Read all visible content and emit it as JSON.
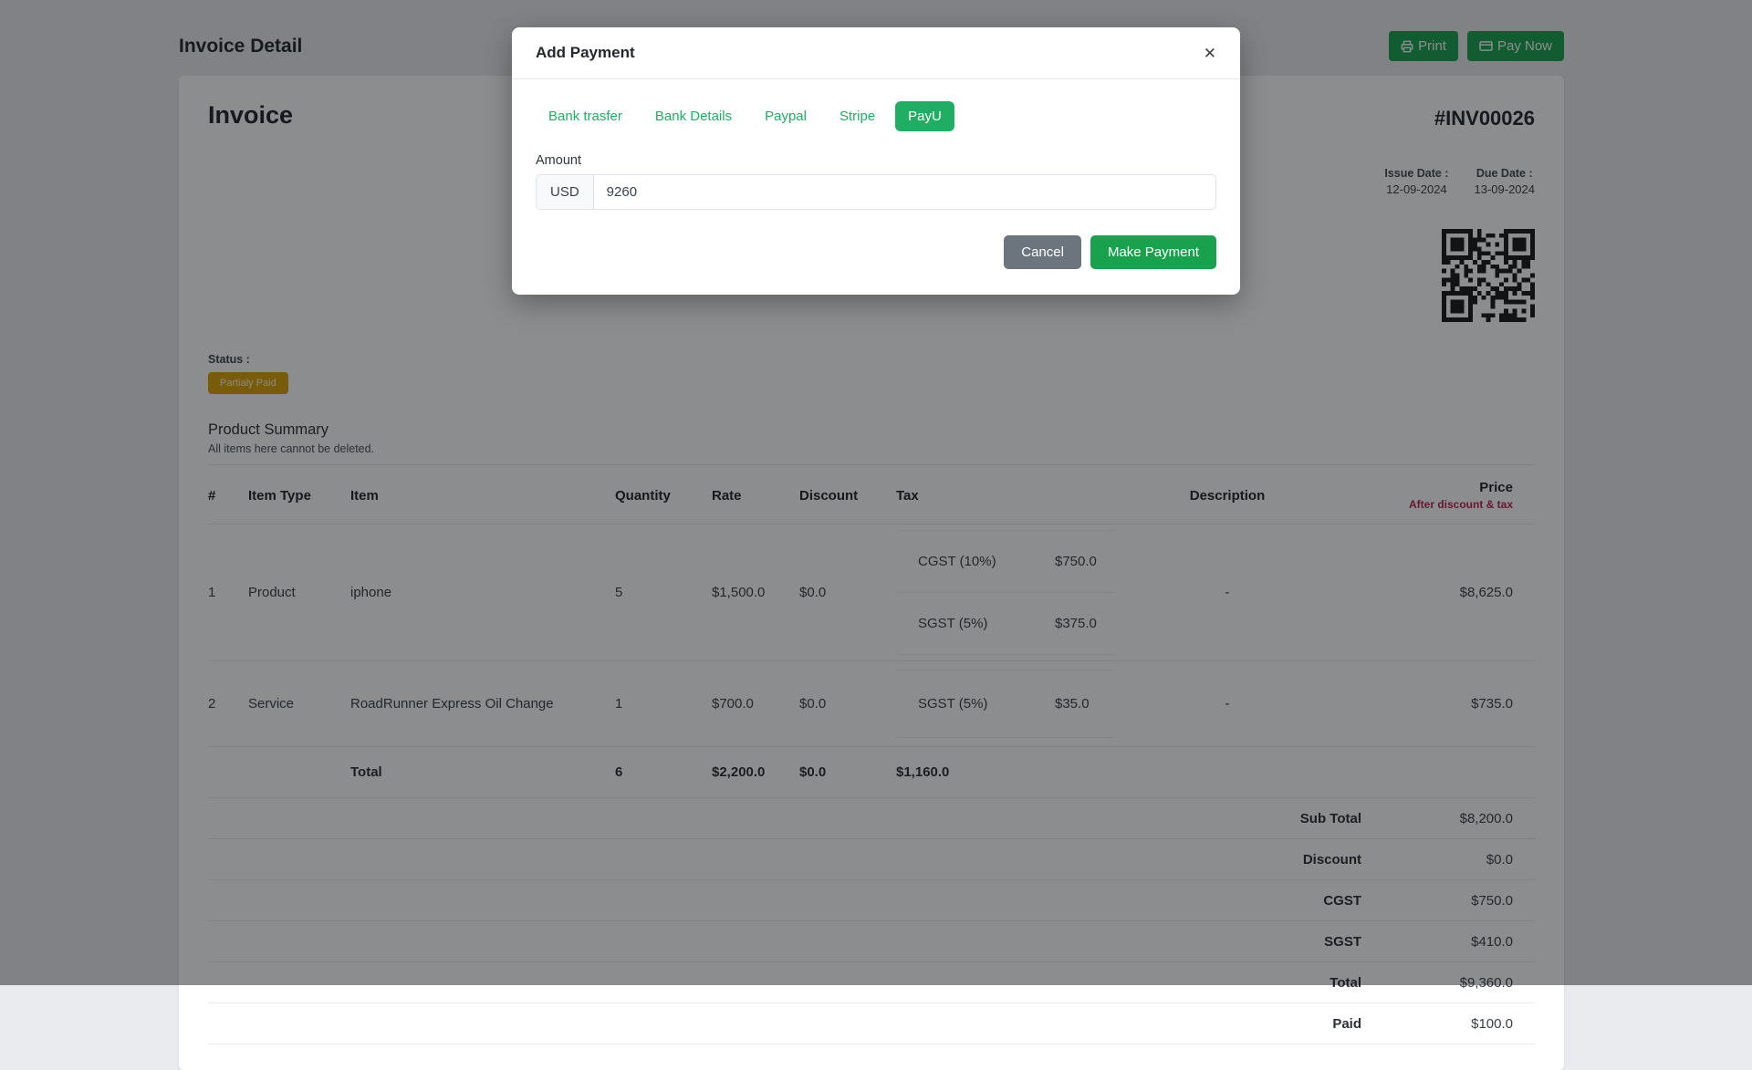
{
  "page": {
    "title": "Invoice Detail",
    "print_label": "Print",
    "pay_now_label": "Pay Now"
  },
  "invoice": {
    "title": "Invoice",
    "number": "#INV00026",
    "issue_date_label": "Issue Date :",
    "issue_date": "12-09-2024",
    "due_date_label": "Due Date :",
    "due_date": "13-09-2024",
    "status_label": "Status :",
    "status": "Partialy Paid"
  },
  "product_summary": {
    "title": "Product Summary",
    "subtitle": "All items here cannot be deleted.",
    "columns": {
      "index": "#",
      "item_type": "Item Type",
      "item": "Item",
      "quantity": "Quantity",
      "rate": "Rate",
      "discount": "Discount",
      "tax": "Tax",
      "description": "Description",
      "price": "Price",
      "price_sub": "After discount & tax"
    },
    "rows": [
      {
        "index": "1",
        "item_type": "Product",
        "item": "iphone",
        "quantity": "5",
        "rate": "$1,500.0",
        "discount": "$0.0",
        "taxes": [
          {
            "name": "CGST (10%)",
            "value": "$750.0"
          },
          {
            "name": "SGST (5%)",
            "value": "$375.0"
          }
        ],
        "description": "-",
        "price": "$8,625.0"
      },
      {
        "index": "2",
        "item_type": "Service",
        "item": "RoadRunner Express Oil Change",
        "quantity": "1",
        "rate": "$700.0",
        "discount": "$0.0",
        "taxes": [
          {
            "name": "SGST (5%)",
            "value": "$35.0"
          }
        ],
        "description": "-",
        "price": "$735.0"
      }
    ],
    "total_row": {
      "label": "Total",
      "quantity": "6",
      "rate": "$2,200.0",
      "discount": "$0.0",
      "tax": "$1,160.0"
    },
    "summary": [
      {
        "label": "Sub Total",
        "value": "$8,200.0"
      },
      {
        "label": "Discount",
        "value": "$0.0"
      },
      {
        "label": "CGST",
        "value": "$750.0"
      },
      {
        "label": "SGST",
        "value": "$410.0"
      },
      {
        "label": "Total",
        "value": "$9,360.0"
      },
      {
        "label": "Paid",
        "value": "$100.0"
      }
    ]
  },
  "modal": {
    "title": "Add Payment",
    "close_glyph": "✕",
    "tabs": [
      {
        "label": "Bank trasfer",
        "active": false
      },
      {
        "label": "Bank Details",
        "active": false
      },
      {
        "label": "Paypal",
        "active": false
      },
      {
        "label": "Stripe",
        "active": false
      },
      {
        "label": "PayU",
        "active": true
      }
    ],
    "amount_label": "Amount",
    "currency": "USD",
    "amount_value": "9260",
    "cancel_label": "Cancel",
    "submit_label": "Make Payment"
  },
  "colors": {
    "accent_green": "#1fae63",
    "button_green": "#18a24e",
    "cancel_gray": "#6c757d",
    "status_amber": "#d9a306",
    "price_note_red": "#bf2250"
  }
}
